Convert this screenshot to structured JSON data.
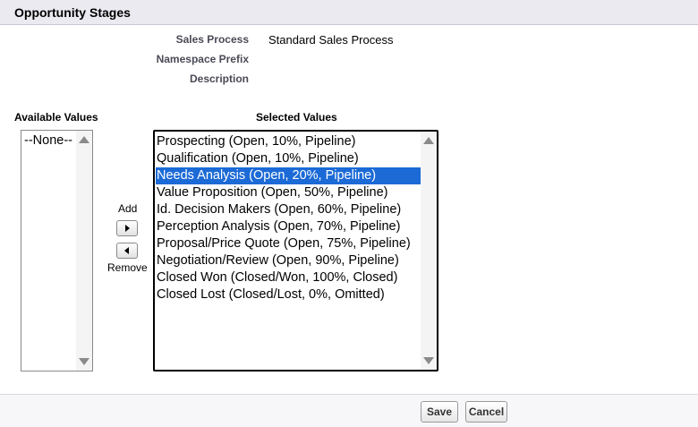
{
  "header": {
    "title": "Opportunity Stages"
  },
  "fields": [
    {
      "label": "Sales Process",
      "value": "Standard Sales Process"
    },
    {
      "label": "Namespace Prefix",
      "value": ""
    },
    {
      "label": "Description",
      "value": ""
    }
  ],
  "available": {
    "title": "Available Values",
    "options": [
      "--None--"
    ]
  },
  "selected": {
    "title": "Selected Values",
    "options": [
      "Prospecting (Open, 10%, Pipeline)",
      "Qualification (Open, 10%, Pipeline)",
      "Needs Analysis (Open, 20%, Pipeline)",
      "Value Proposition (Open, 50%, Pipeline)",
      "Id. Decision Makers (Open, 60%, Pipeline)",
      "Perception Analysis (Open, 70%, Pipeline)",
      "Proposal/Price Quote (Open, 75%, Pipeline)",
      "Negotiation/Review (Open, 90%, Pipeline)",
      "Closed Won (Closed/Won, 100%, Closed)",
      "Closed Lost (Closed/Lost, 0%, Omitted)"
    ],
    "highlighted_index": 2,
    "highlight_color": "#1b6ad6"
  },
  "mover": {
    "add_label": "Add",
    "remove_label": "Remove",
    "add_icon": "arrow-right-icon",
    "remove_icon": "arrow-left-icon"
  },
  "actions": {
    "save_label": "Save",
    "cancel_label": "Cancel"
  }
}
